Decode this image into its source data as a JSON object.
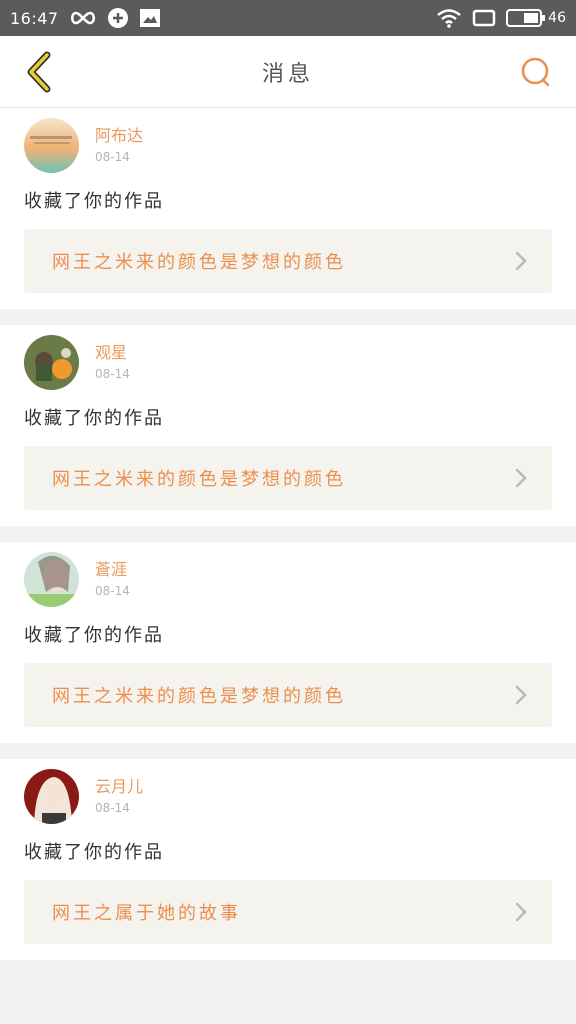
{
  "status": {
    "time": "16:47",
    "battery": "46"
  },
  "header": {
    "title": "消息",
    "back_icon": "chevron-left-icon",
    "search_icon": "search-icon"
  },
  "colors": {
    "accent": "#ec8f4e",
    "back": "#e8cf2e"
  },
  "notifications": [
    {
      "username": "阿布达",
      "date": "08-14",
      "action": "收藏了你的作品",
      "work": "网王之米来的颜色是梦想的颜色"
    },
    {
      "username": "观星",
      "date": "08-14",
      "action": "收藏了你的作品",
      "work": "网王之米来的颜色是梦想的颜色"
    },
    {
      "username": "蒼涯",
      "date": "08-14",
      "action": "收藏了你的作品",
      "work": "网王之米来的颜色是梦想的颜色"
    },
    {
      "username": "云月儿",
      "date": "08-14",
      "action": "收藏了你的作品",
      "work": "网王之属于她的故事"
    }
  ]
}
